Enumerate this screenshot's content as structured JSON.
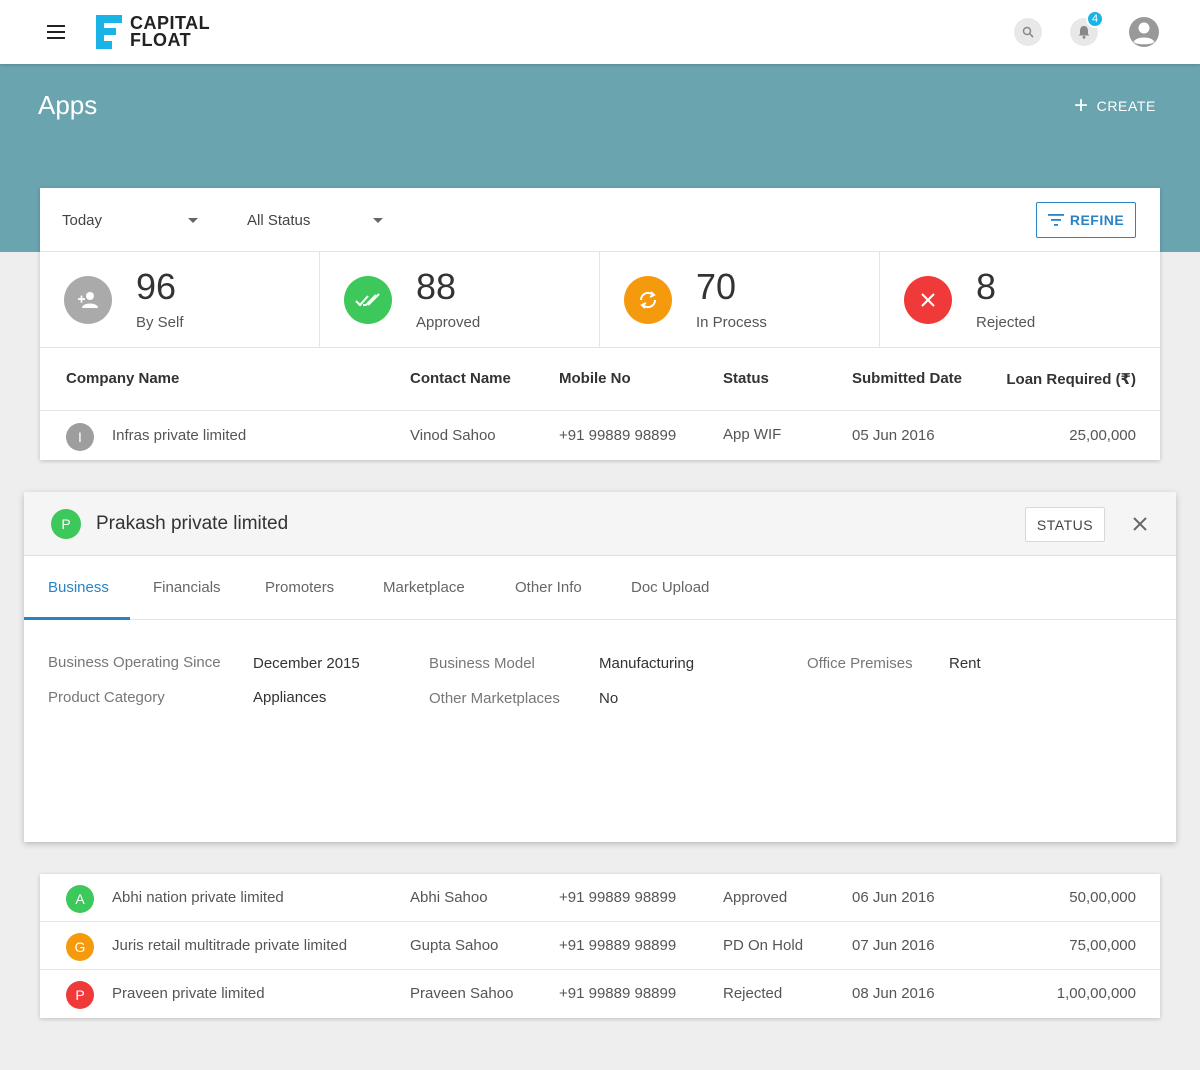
{
  "brand": {
    "line1": "CAPITAL",
    "line2": "FLOAT"
  },
  "notifications": {
    "count": "4"
  },
  "page": {
    "title": "Apps",
    "create_label": "CREATE"
  },
  "filters": {
    "date": "Today",
    "status": "All Status",
    "refine_label": "REFINE"
  },
  "stats": [
    {
      "value": "96",
      "label": "By Self",
      "color": "#aaaaaa",
      "icon": "add-person-icon"
    },
    {
      "value": "88",
      "label": "Approved",
      "color": "#3cc85a",
      "icon": "double-check-icon"
    },
    {
      "value": "70",
      "label": "In Process",
      "color": "#f59a0c",
      "icon": "sync-icon"
    },
    {
      "value": "8",
      "label": "Rejected",
      "color": "#f03a3a",
      "icon": "close-icon"
    }
  ],
  "table": {
    "columns": [
      "Company Name",
      "Contact Name",
      "Mobile No",
      "Status",
      "Submitted Date",
      "Loan Required (₹)"
    ],
    "rows": [
      {
        "letter": "I",
        "letter_color": "#9e9e9e",
        "company": "Infras private limited",
        "contact": "Vinod Sahoo",
        "mobile": "+91 99889 98899",
        "status": "App WIF",
        "date": "05 Jun 2016",
        "loan": "25,00,000"
      },
      {
        "letter": "A",
        "letter_color": "#3cc85a",
        "company": "Abhi nation private limited",
        "contact": "Abhi Sahoo",
        "mobile": "+91 99889 98899",
        "status": "Approved",
        "date": "06 Jun 2016",
        "loan": "50,00,000"
      },
      {
        "letter": "G",
        "letter_color": "#f59a0c",
        "company": "Juris retail multitrade private limited",
        "contact": "Gupta Sahoo",
        "mobile": "+91 99889 98899",
        "status": "PD On Hold",
        "date": "07 Jun 2016",
        "loan": "75,00,000"
      },
      {
        "letter": "P",
        "letter_color": "#f03a3a",
        "company": "Praveen private limited",
        "contact": "Praveen Sahoo",
        "mobile": "+91 99889 98899",
        "status": "Rejected",
        "date": "08 Jun 2016",
        "loan": "1,00,00,000"
      }
    ]
  },
  "detail": {
    "letter": "P",
    "title": "Prakash private limited",
    "status_label": "STATUS",
    "tabs": [
      "Business",
      "Financials",
      "Promoters",
      "Marketplace",
      "Other Info",
      "Doc Upload"
    ],
    "active_tab": "Business",
    "fields": [
      {
        "label": "Business Operating Since",
        "value": "December 2015"
      },
      {
        "label": "Business Model",
        "value": "Manufacturing"
      },
      {
        "label": "Office Premises",
        "value": "Rent"
      },
      {
        "label": "Product Category",
        "value": "Appliances"
      },
      {
        "label": "Other Marketplaces",
        "value": "No"
      }
    ]
  },
  "colors": {
    "teal": "#6aa4af",
    "accent": "#2a83c4"
  }
}
